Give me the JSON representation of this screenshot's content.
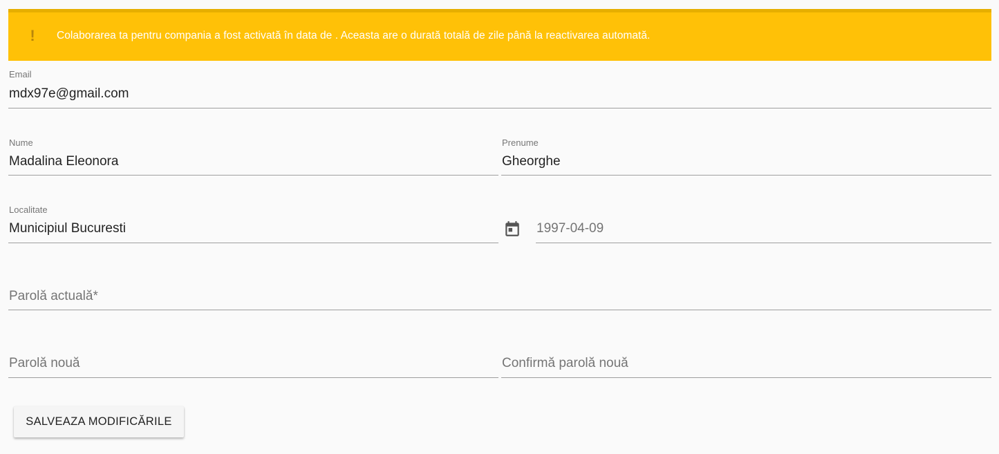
{
  "alert": {
    "icon": "exclamation-icon",
    "icon_glyph": "!",
    "message": "Colaborarea ta pentru compania a fost activată în data de . Aceasta are o durată totală de zile până la reactivarea automată.",
    "background_color": "#ffc107",
    "border_color": "#e6ae00"
  },
  "form": {
    "email": {
      "label": "Email",
      "value": "mdx97e@gmail.com"
    },
    "nume": {
      "label": "Nume",
      "value": "Madalina Eleonora"
    },
    "prenume": {
      "label": "Prenume",
      "value": "Gheorghe"
    },
    "localitate": {
      "label": "Localitate",
      "value": "Municipiul Bucuresti"
    },
    "birth_date": {
      "icon": "calendar-icon",
      "value": "1997-04-09"
    },
    "current_password": {
      "placeholder": "Parolă actuală*"
    },
    "new_password": {
      "placeholder": "Parolă nouă"
    },
    "confirm_password": {
      "placeholder": "Confirmă parolă nouă"
    },
    "save_label": "SALVEAZA MODIFICĂRILE"
  }
}
